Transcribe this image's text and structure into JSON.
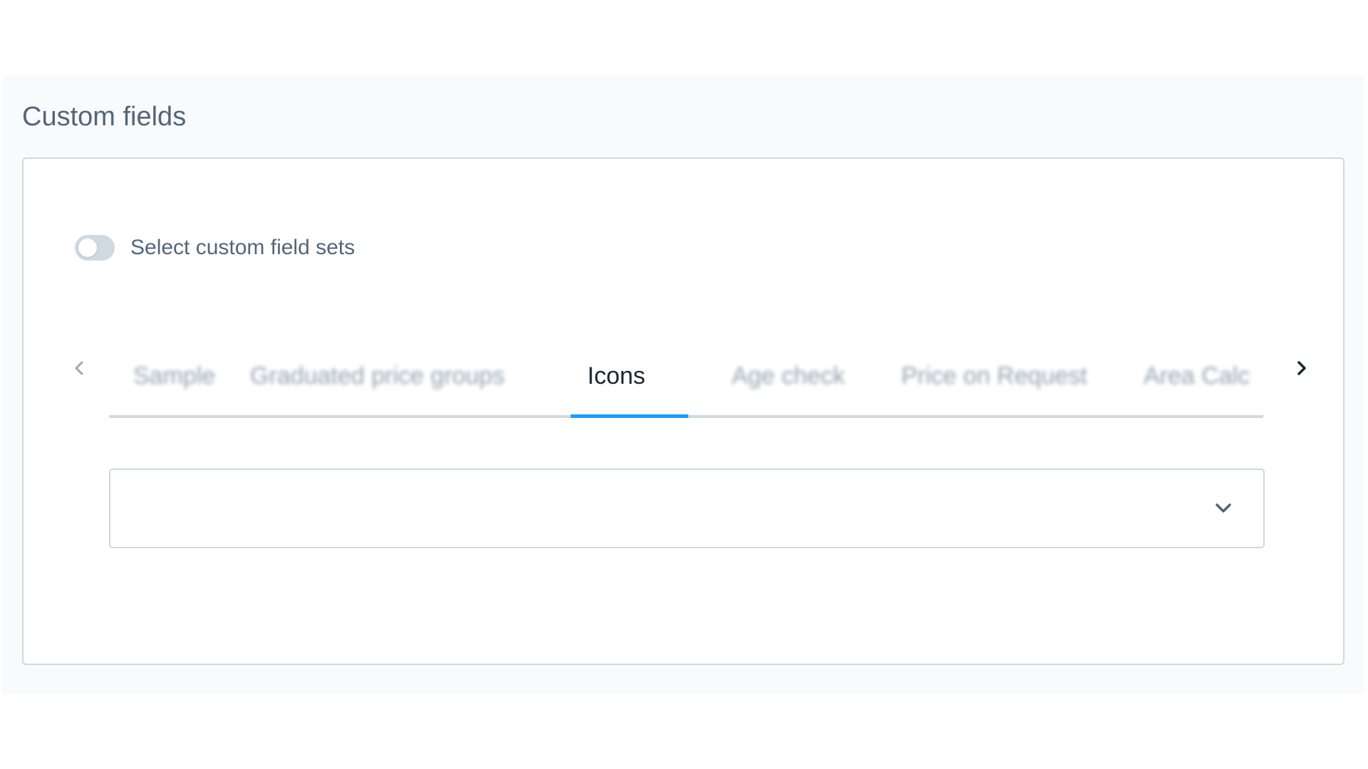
{
  "section": {
    "title": "Custom fields"
  },
  "toggle": {
    "label": "Select custom field sets",
    "checked": false
  },
  "tabs": {
    "items": [
      {
        "label": "Sample",
        "active": false
      },
      {
        "label": "Graduated price groups",
        "active": false
      },
      {
        "label": "Icons",
        "active": true
      },
      {
        "label": "Age check",
        "active": false
      },
      {
        "label": "Price on Request",
        "active": false
      },
      {
        "label": "Area Calc",
        "active": false
      }
    ],
    "prev_icon": "chevron-left-icon",
    "next_icon": "chevron-right-icon"
  },
  "select": {
    "value": "",
    "icon": "chevron-down-icon"
  },
  "colors": {
    "accent": "#189eff",
    "text_muted": "#52667a",
    "border": "#d1d9e0"
  }
}
